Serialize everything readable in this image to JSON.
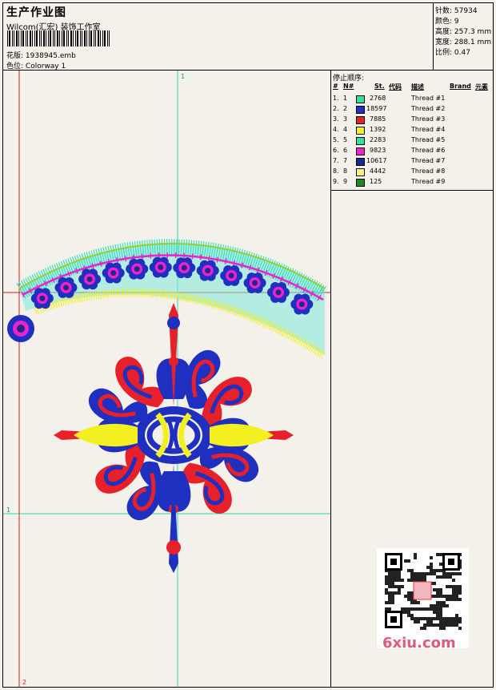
{
  "header": {
    "title": "生产作业图",
    "subtitle": "Wilcom(汇宏) 装饰工作室",
    "design_label": "花版:",
    "design_value": "1938945.emb",
    "colorway_label": "色位:",
    "colorway_value": "Colorway 1"
  },
  "stats": [
    {
      "label": "针数:",
      "value": "57934"
    },
    {
      "label": "颜色:",
      "value": "9"
    },
    {
      "label": "高度:",
      "value": "257.3 mm"
    },
    {
      "label": "宽度:",
      "value": "288.1 mm"
    },
    {
      "label": "比例:",
      "value": "0.47"
    }
  ],
  "sequence": {
    "title": "停止顺序:",
    "columns": [
      "#",
      "N#",
      "St.",
      "代码",
      "描述",
      "Brand",
      "元素"
    ],
    "rows": [
      {
        "idx": "1.",
        "n": "1",
        "color": "#33e0a0",
        "st": "2768",
        "desc": "Thread #1"
      },
      {
        "idx": "2.",
        "n": "2",
        "color": "#1f2fbf",
        "st": "18597",
        "desc": "Thread #2"
      },
      {
        "idx": "3.",
        "n": "3",
        "color": "#e8202a",
        "st": "7885",
        "desc": "Thread #3"
      },
      {
        "idx": "4.",
        "n": "4",
        "color": "#f4f020",
        "st": "1392",
        "desc": "Thread #4"
      },
      {
        "idx": "5.",
        "n": "5",
        "color": "#33e0a0",
        "st": "2283",
        "desc": "Thread #5"
      },
      {
        "idx": "6.",
        "n": "6",
        "color": "#ee22cc",
        "st": "9823",
        "desc": "Thread #6"
      },
      {
        "idx": "7.",
        "n": "7",
        "color": "#1a2a8a",
        "st": "10617",
        "desc": "Thread #7"
      },
      {
        "idx": "8.",
        "n": "8",
        "color": "#f8f078",
        "st": "4442",
        "desc": "Thread #8"
      },
      {
        "idx": "9.",
        "n": "9",
        "color": "#1c8a20",
        "st": "125",
        "desc": "Thread #9"
      }
    ]
  },
  "markers": {
    "top": "1",
    "left": "1",
    "right": "2",
    "bottom": "2"
  },
  "watermark": "6xiu.com",
  "colors": {
    "blue": "#1f2fbf",
    "red": "#e8202a",
    "yellow": "#f4f020",
    "cyan": "#33e0c0",
    "magenta": "#ee22cc",
    "navy": "#1a2a8a",
    "guide_cyan": "#33d6b0",
    "guide_red": "#d42020"
  }
}
